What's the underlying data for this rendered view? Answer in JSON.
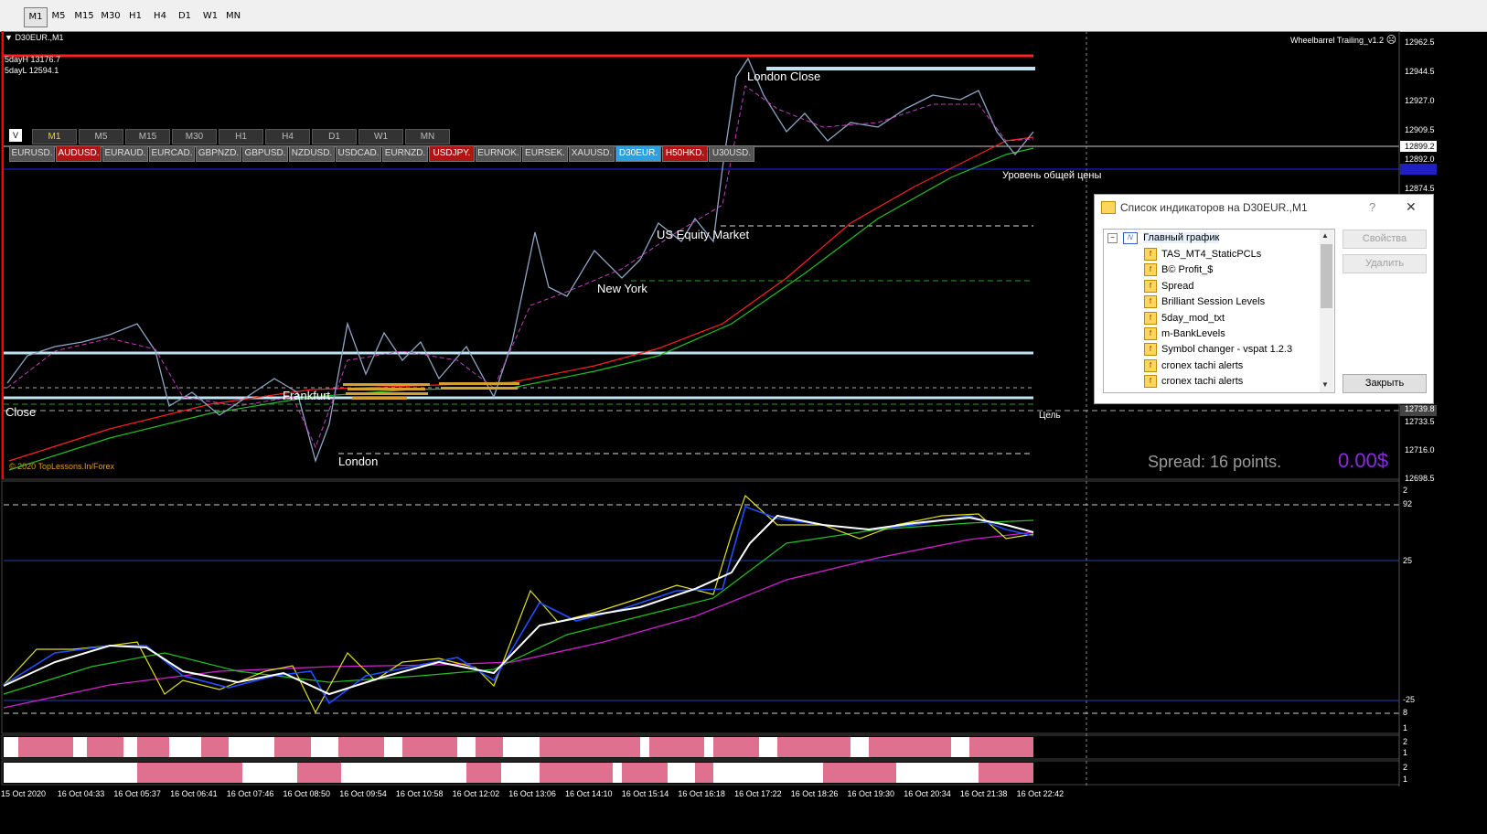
{
  "toolbar": {
    "timeframes": [
      "M1",
      "M5",
      "M15",
      "M30",
      "H1",
      "H4",
      "D1",
      "W1",
      "MN"
    ],
    "active": "M1"
  },
  "chart": {
    "symbol_title": "D30EUR.,M1",
    "info_5day_high": "5dayH 13176.7",
    "info_5day_low": "5dayL 12594.1",
    "ea_name": "Wheelbarrel Trailing_v1.2",
    "copyright": "© 2020 TopLessons.In/Forex",
    "spread_text": "Spread: 16 points.",
    "profit_text": "0.00$",
    "session_labels": {
      "london_close_top": "London Close",
      "us_equity": "US Equity Market",
      "new_york": "New York",
      "frankfurt": "Frankfurt",
      "london": "London",
      "close_left": "Close",
      "level_common": "Уровень общей цены",
      "target": "Цель"
    },
    "v_button": "V",
    "tf_buttons": [
      "M1",
      "M5",
      "M15",
      "M30",
      "H1",
      "H4",
      "D1",
      "W1",
      "MN"
    ],
    "symbols": [
      {
        "label": "EURUSD.",
        "state": "normal"
      },
      {
        "label": "AUDUSD.",
        "state": "red"
      },
      {
        "label": "EURAUD.",
        "state": "normal"
      },
      {
        "label": "EURCAD.",
        "state": "normal"
      },
      {
        "label": "GBPNZD.",
        "state": "normal"
      },
      {
        "label": "GBPUSD.",
        "state": "normal"
      },
      {
        "label": "NZDUSD.",
        "state": "normal"
      },
      {
        "label": "USDCAD.",
        "state": "normal"
      },
      {
        "label": "EURNZD.",
        "state": "normal"
      },
      {
        "label": "USDJPY.",
        "state": "red"
      },
      {
        "label": "EURNOK.",
        "state": "normal"
      },
      {
        "label": "EURSEK.",
        "state": "normal"
      },
      {
        "label": "XAUUSD.",
        "state": "normal"
      },
      {
        "label": "D30EUR.",
        "state": "blue"
      },
      {
        "label": "H50HKD.",
        "state": "red"
      },
      {
        "label": "U30USD.",
        "state": "normal"
      }
    ],
    "price_axis": [
      "12962.5",
      "12944.5",
      "12927.0",
      "12909.5",
      "12899.2",
      "12892.0",
      "12874.5",
      "12739.8",
      "12733.5",
      "12716.0",
      "12698.5"
    ],
    "current_price": "12899.2",
    "osc_axis": [
      "2",
      "92",
      "25",
      "-25",
      "8",
      "1"
    ],
    "bar_axis_1": [
      "2",
      "1"
    ],
    "bar_axis_2": [
      "2",
      "1"
    ],
    "time_axis": [
      "15 Oct 2020",
      "16 Oct 04:33",
      "16 Oct 05:37",
      "16 Oct 06:41",
      "16 Oct 07:46",
      "16 Oct 08:50",
      "16 Oct 09:54",
      "16 Oct 10:58",
      "16 Oct 12:02",
      "16 Oct 13:06",
      "16 Oct 14:10",
      "16 Oct 15:14",
      "16 Oct 16:18",
      "16 Oct 17:22",
      "16 Oct 18:26",
      "16 Oct 19:30",
      "16 Oct 20:34",
      "16 Oct 21:38",
      "16 Oct 22:42"
    ]
  },
  "dialog": {
    "title": "Список индикаторов на D30EUR.,M1",
    "help": "?",
    "close": "✕",
    "root": "Главный график",
    "indicators": [
      "TAS_MT4_StaticPCLs",
      "B© Profit_$",
      "Spread",
      "Brilliant Session Levels",
      "5day_mod_txt",
      "m-BankLevels",
      "Symbol changer - vspat 1.2.3",
      "cronex tachi alerts",
      "cronex tachi alerts"
    ],
    "btn_properties": "Свойства",
    "btn_delete": "Удалить",
    "btn_close": "Закрыть"
  },
  "colors": {
    "ma_red": "#ff2020",
    "ma_green": "#22c022",
    "level_light": "#bfe3f0",
    "pink_bars": "#e07090",
    "profit": "#8a2be2"
  }
}
